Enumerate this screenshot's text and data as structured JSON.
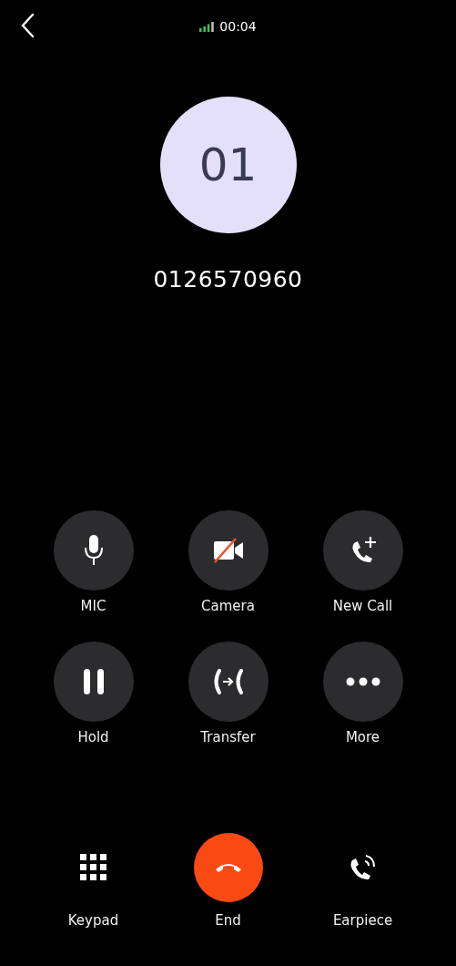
{
  "status": {
    "duration": "00:04"
  },
  "contact": {
    "avatar_text": "01",
    "number": "0126570960"
  },
  "controls": [
    {
      "label": "MIC",
      "kind": "mic"
    },
    {
      "label": "Camera",
      "kind": "camera-off"
    },
    {
      "label": "New Call",
      "kind": "add-call"
    },
    {
      "label": "Hold",
      "kind": "hold"
    },
    {
      "label": "Transfer",
      "kind": "transfer"
    },
    {
      "label": "More",
      "kind": "more"
    }
  ],
  "bottom_actions": [
    {
      "label": "Keypad",
      "kind": "keypad"
    },
    {
      "label": "End",
      "kind": "end"
    },
    {
      "label": "Earpiece",
      "kind": "earpiece"
    }
  ]
}
